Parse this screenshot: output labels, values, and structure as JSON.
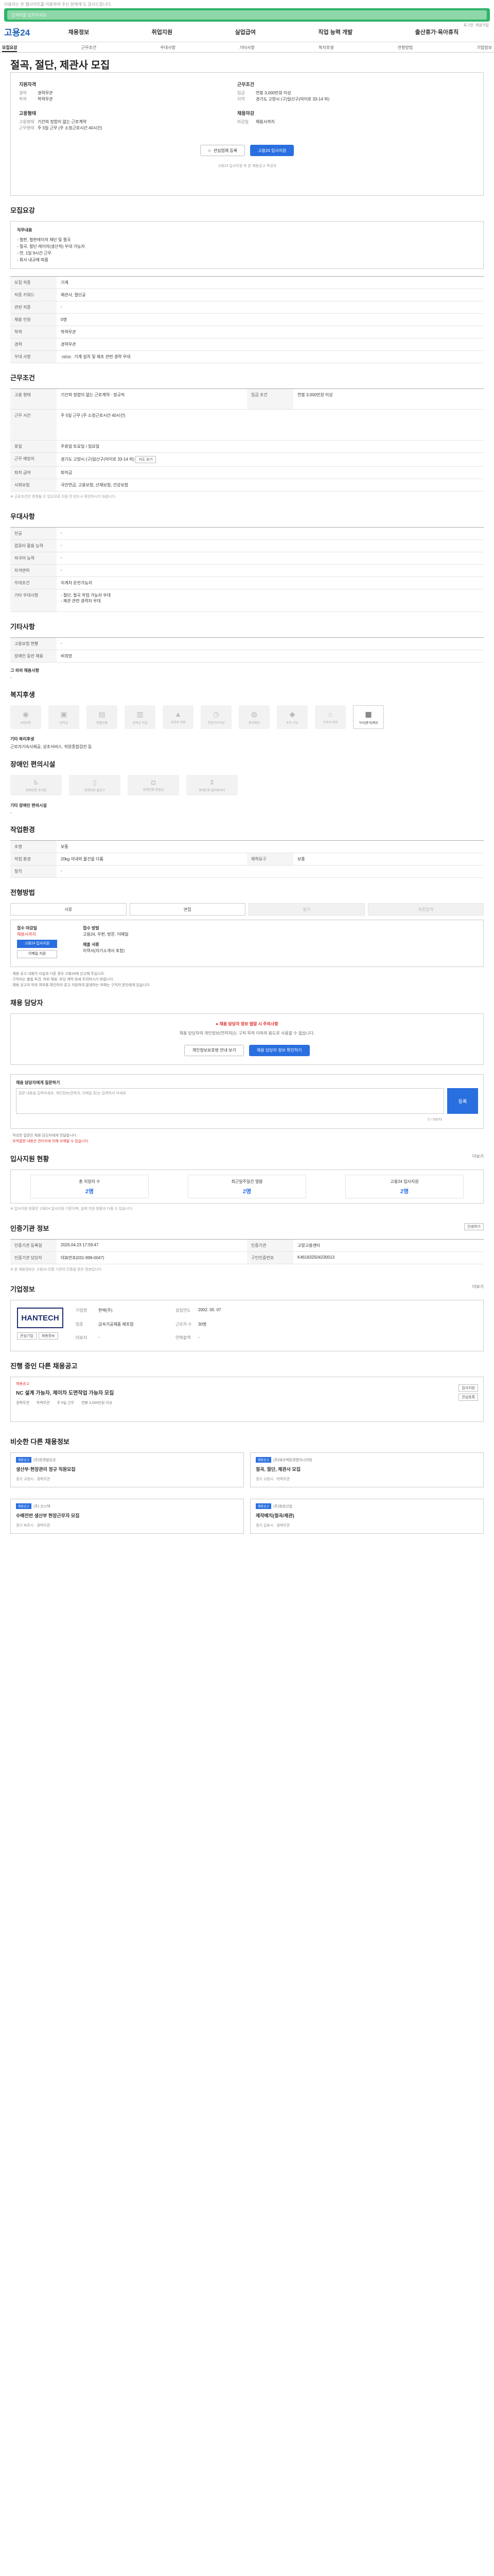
{
  "topbar": {
    "text": "이용자는 본 웹사이트를 이용하여 주신 분에게 도 감사드립니다."
  },
  "search": {
    "placeholder": "검색어를 입력하세요"
  },
  "header": {
    "logo": "고용24",
    "nav": [
      "채용정보",
      "취업지원",
      "실업급여",
      "직업 능력 개발",
      "출산휴가·육아휴직"
    ],
    "mini_links": [
      "로그인",
      "회원가입"
    ]
  },
  "tabs": [
    "모집요강",
    "근무조건",
    "우대사항",
    "기타사항",
    "복지후생",
    "전형방법",
    "기업정보"
  ],
  "title": "절곡, 절단, 제관사 모집",
  "summary": {
    "left_head": "지원자격",
    "left": [
      {
        "k": "경력",
        "v": "경력무관"
      },
      {
        "k": "학력",
        "v": "학력무관"
      }
    ],
    "left_head2": "고용형태",
    "left2": [
      {
        "k": "고용형태",
        "v": "기간의 정함이 없는 근로계약"
      },
      {
        "k": "근무형태",
        "v": "주 5일 근무 (주 소정근로시간 40시간)"
      }
    ],
    "right_head": "근무조건",
    "right": [
      {
        "k": "임금",
        "v": "연봉 3,000만원 이상"
      },
      {
        "k": "지역",
        "v": "경기도 고양시 (구)일산구(덕이로 33-14 외)"
      }
    ],
    "right_head2": "채용마감",
    "right2": [
      {
        "k": "마감일",
        "v": "채용시까지"
      }
    ],
    "btn_scrap": "관심업체 등록",
    "btn_apply": "고용24 입사지원",
    "note": "고용24 입사지원 후 본 채용공고 작성자 "
  },
  "recruit": {
    "title": "모집요강",
    "box_head": "직무내용",
    "box_lines": [
      "- 철판, 철판레이저 재단 및 절곡",
      "- 절곡, 절단 레이저(생산직) 우대 가능자",
      "- 연, 1일 9시간 근무",
      "- 회사 내규에 따름"
    ],
    "rows": [
      {
        "k": "모집 직종",
        "v": "기계"
      },
      {
        "k": "직종 키워드",
        "v": "제관사, 절단공"
      },
      {
        "k": "관련 직종",
        "v": "-"
      },
      {
        "k": "채용 인원",
        "v": "0명"
      },
      {
        "k": "학력",
        "v": "학력무관"
      },
      {
        "k": "경력",
        "v": "경력무관"
      },
      {
        "k": "우대 사항",
        "v": "기계 설치 및 제조 관련 경력 우대"
      }
    ]
  },
  "conditions": {
    "title": "근무조건",
    "rows": [
      {
        "k": "고용 형태",
        "v": "기간의 정함이 없는 근로계약 · 정규직"
      },
      {
        "k": "임금 조건",
        "v": "연봉 3,000만원 이상"
      },
      {
        "k": "근무 시간",
        "v": "주 5일 근무 (주 소정근로시간 40시간)"
      },
      {
        "k": "휴일",
        "v": "주휴일 토요일 / 일요일"
      },
      {
        "k": "근무 예정지",
        "v": "경기도 고양시 (구)일산구(덕이로 33-14 외)"
      },
      {
        "k": "퇴직 급여",
        "v": "퇴직금"
      },
      {
        "k": "사회보험",
        "v": "국민연금, 고용보험, 산재보험, 건강보험"
      }
    ],
    "map_btn": "지도 보기",
    "note": "※ 근로조건은 변경될 수 있으므로 지원 전 반드시 확인하시기 바랍니다."
  },
  "preferences": {
    "title": "우대사항",
    "rows": [
      {
        "k": "전공",
        "v": "-"
      },
      {
        "k": "컴퓨터 활용 능력",
        "v": "-"
      },
      {
        "k": "외국어 능력",
        "v": "-"
      },
      {
        "k": "자격면허",
        "v": "-"
      },
      {
        "k": "우대조건",
        "v": "지게차 운전가능자"
      },
      {
        "k": "기타 우대사항",
        "v": "- 절단, 절곡 작업 가능자 우대\n- 제관 관련 경력자 우대"
      }
    ]
  },
  "etc": {
    "title": "기타사항",
    "rows": [
      {
        "k": "고용보험 현황",
        "v": "-"
      },
      {
        "k": "장애인 동반 채용",
        "v": "비희망"
      }
    ],
    "extra_label": "그 외의 채용사항",
    "extra_value": "-"
  },
  "welfare": {
    "title": "복지후생",
    "cards": [
      {
        "icon": "person-icon",
        "label": "4대보험"
      },
      {
        "icon": "box-icon",
        "label": "퇴직금"
      },
      {
        "icon": "gift-icon",
        "label": "명절선물"
      },
      {
        "icon": "graph-icon",
        "label": "상여금 지급"
      },
      {
        "icon": "cap-icon",
        "label": "교육비 지원"
      },
      {
        "icon": "clock-icon",
        "label": "연장근로수당"
      },
      {
        "icon": "meal-icon",
        "label": "중식제공"
      },
      {
        "icon": "car-icon",
        "label": "주차 가능"
      },
      {
        "icon": "home-icon",
        "label": "기숙사 제공"
      },
      {
        "icon": "building-icon",
        "label": "식사(중식)제공"
      }
    ],
    "active_index": 9,
    "extra_label": "기타 복리후생",
    "extra_value": "근로자기숙사제공, 상조서비스, 직원종합검진 등"
  },
  "disability": {
    "title": "장애인 편의시설",
    "cards": [
      {
        "icon": "ramp-icon",
        "label": "장애인용 주차장"
      },
      {
        "icon": "door-icon",
        "label": "장애인용 출입구"
      },
      {
        "icon": "toilet-icon",
        "label": "장애인용 화장실"
      },
      {
        "icon": "elevator-icon",
        "label": "장애인용 엘리베이터"
      }
    ],
    "extra_label": "기타 장애인 편의시설",
    "extra_value": "-"
  },
  "workenv": {
    "title": "작업환경",
    "rows": [
      {
        "k": "조명",
        "v": "보통"
      },
      {
        "k": "작업 환경",
        "v": "20kg 이내의 물건을 다룸"
      },
      {
        "k": "체력요구",
        "v": "보통"
      },
      {
        "k": "청각",
        "v": "-"
      }
    ]
  },
  "process": {
    "title": "전형방법",
    "steps": [
      "서류",
      "면접",
      "필기",
      "최종합격"
    ],
    "active_steps": 2,
    "apply_method_label": "접수 마감일",
    "apply_method_value": "채용시까지",
    "apply_ways_label": "접수 방법",
    "apply_ways_value": "고용24, 우편, 방문, 이메일",
    "btn_apply": "고용24 입사지원",
    "btn_email": "이메일 지원",
    "doc_label": "제출 서류",
    "doc_value": "이력서(자기소개서 포함)"
  },
  "bullets": [
    "· 채용 공고 내용이 사실과 다른 경우 고용24에 신고해 주십시오.",
    "· 구직자는 불법 파견, 허위 채용, 부당 계약 등에 주의하시기 바랍니다.",
    "· 채용 공고의 허위 여부를 확인하지 않고 지원하여 발생하는 피해는 구직자 본인에게 있습니다."
  ],
  "privacy": {
    "title": "채용 담당자",
    "headline": "채용 담당자 정보 열람 시 주의사항",
    "text": "채용 담당자의 개인정보(연락처)는 구직 목적 이외의 용도로 사용할 수 없습니다.",
    "btn_left": "개인정보보호법 안내 보기",
    "btn_right": "채용 담당자 정보 확인하기"
  },
  "inquiry": {
    "title": "채용 담당자에게 질문하기",
    "placeholder": "질문 내용을 입력하세요. 개인정보(연락처, 이메일 등)는 입력하지 마세요.",
    "counter": "0 / 500자",
    "send": "등록",
    "notes": [
      "· 작성한 질문은 채용 담당자에게 전달됩니다.",
      "· 부적절한 내용은 관리자에 의해 삭제될 수 있습니다."
    ]
  },
  "stats": {
    "title": "입사지원 현황",
    "more": "더보기",
    "items": [
      {
        "label": "총 지원자 수",
        "value": "2명"
      },
      {
        "label": "최근일주일간 열람",
        "value": "2명"
      },
      {
        "label": "고용24 입사지원",
        "value": "2명"
      }
    ],
    "note": "※ 입사지원 현황은 고용24 입사지원 기준이며, 실제 지원 현황과 다를 수 있습니다."
  },
  "verify": {
    "title": "인증기관 정보",
    "print_btn": "인쇄하기",
    "rows": [
      {
        "k": "인증기관 등록일",
        "v": "2025.04.23 17:59:47"
      },
      {
        "k": "인증기관",
        "v": "고양고용센터"
      },
      {
        "k": "인증기관 담당자",
        "v": "대표번호(031-999-0047)"
      },
      {
        "k": "구인인증번호",
        "v": "K461832504230013"
      }
    ],
    "note": "※ 본 채용정보는 고용24 인증 기관의 인증을 받은 정보입니다."
  },
  "company": {
    "title": "기업정보",
    "more": "더보기",
    "logo": "HANTECH",
    "rows": [
      {
        "k": "기업명",
        "v": "한텍(주)"
      },
      {
        "k": "업종",
        "v": "금속가공제품 제조업"
      },
      {
        "k": "대표자",
        "v": "-"
      },
      {
        "k": "설립연도",
        "v": "2002. 05. 07"
      },
      {
        "k": "근로자 수",
        "v": "30명"
      },
      {
        "k": "연매출액",
        "v": "-"
      }
    ],
    "btn_like": "관심기업",
    "btn_jobs": "채용정보"
  },
  "more_jobs": {
    "title": "진행 중인 다른 채용공고",
    "card": {
      "badge": "채용공고",
      "title": "NC 설계 가능자, 제이차 도면작업 가능자 모집",
      "meta": [
        "경력무관",
        "학력무관",
        "주 5일 근무",
        "연봉 3,000만원 이상"
      ],
      "btns": [
        "입사지원",
        "관심등록"
      ]
    }
  },
  "similar": {
    "title": "비슷한 다른 채용정보",
    "items": [
      {
        "badge": "채용공고",
        "company": "(주)한경빌딩공",
        "title": "생산부·현장관리 정규 직원모집",
        "meta": "경기 고양시 · 경력무관"
      },
      {
        "badge": "채용공고",
        "company": "(주)에코텍환경엔지니어링",
        "title": "절곡, 절단, 제관사 모집",
        "meta": "경기 고양시 · 학력무관"
      },
      {
        "badge": "채용공고",
        "company": "(주) 코스텍",
        "title": "수배전반 생산부 현장근무자 모집",
        "meta": "경기 파주시 · 경력무관"
      },
      {
        "badge": "채용공고",
        "company": "(주)동양산업",
        "title": "제작배치(절곡/제관)",
        "meta": "경기 김포시 · 경력무관"
      }
    ]
  },
  "colors": {
    "brand_green": "#2fb368",
    "primary_blue": "#2a6fe0",
    "warning_red": "#e12b2b",
    "logo_navy": "#1e2f6c"
  }
}
